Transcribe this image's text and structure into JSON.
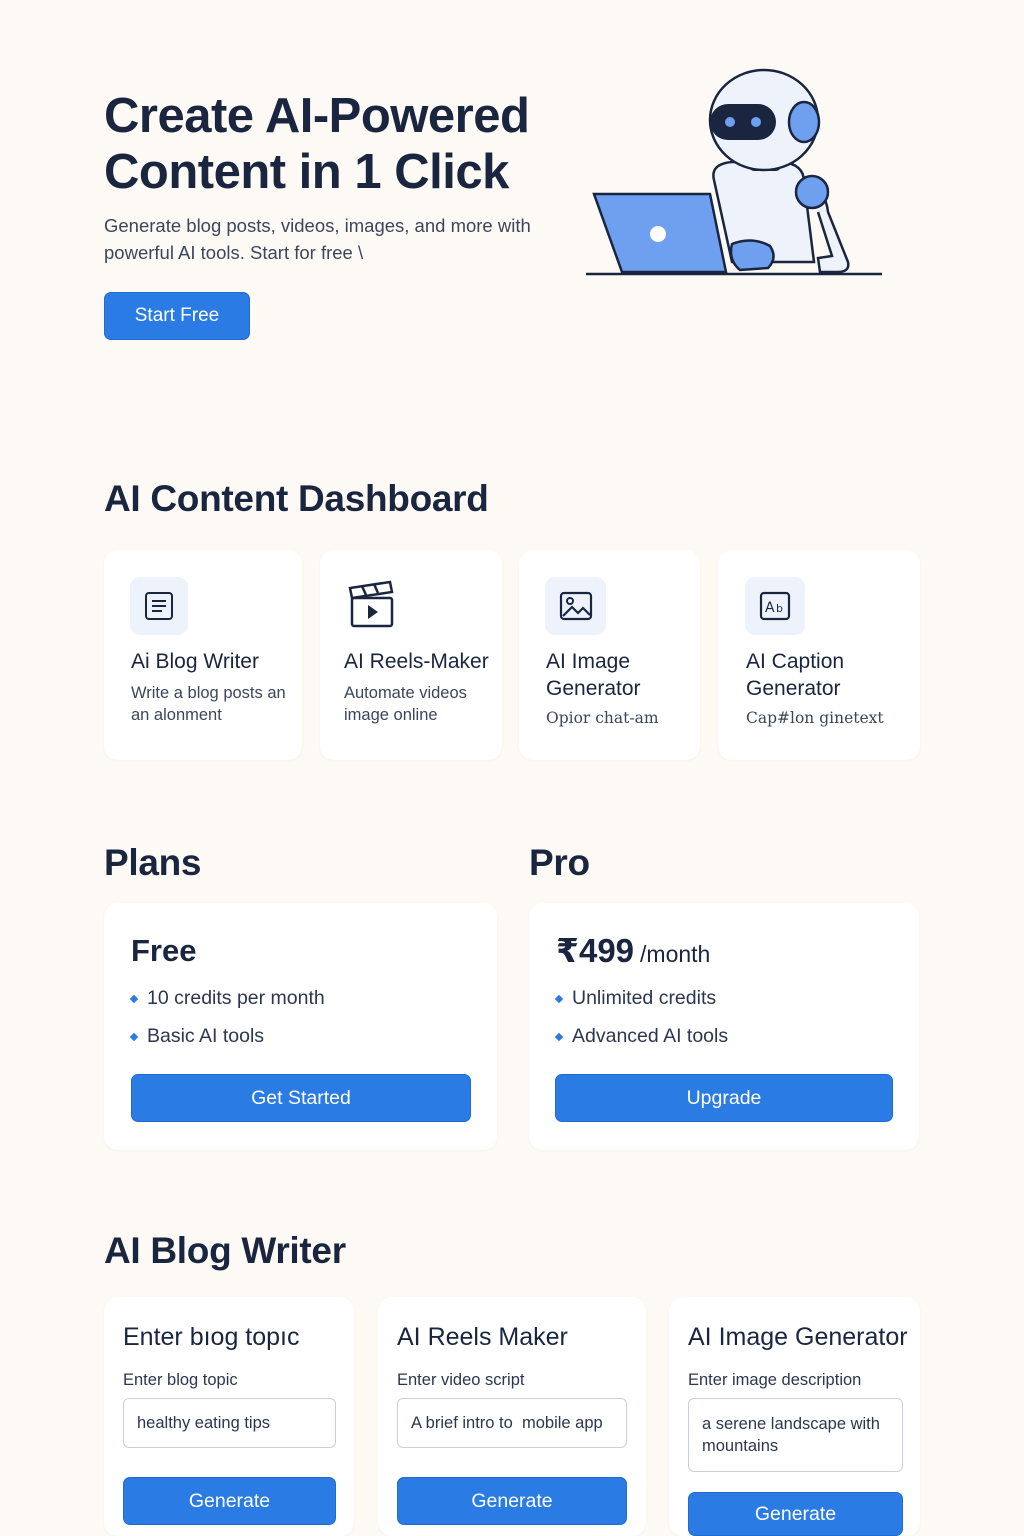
{
  "hero": {
    "title": "Create AI-Powered Content in 1 Click",
    "subtitle": "Generate blog posts, videos, images, and more with powerful AI tools. Start for free \\",
    "cta_label": "Start Free",
    "illustration": "robot-with-laptop"
  },
  "dashboard": {
    "title": "AI Content Dashboard",
    "features": [
      {
        "name": "Ai Blog Writer",
        "desc": "Write a blog posts an an alonment",
        "icon": "document-icon"
      },
      {
        "name": "AI Reels-Maker",
        "desc": "Automate videos image online",
        "icon": "clapperboard-icon"
      },
      {
        "name": "AI Image Generator",
        "desc": "Opior chat-am",
        "icon": "image-icon"
      },
      {
        "name": "AI Caption Generator",
        "desc": "Cap#lon ginetext",
        "icon": "caption-icon"
      }
    ]
  },
  "plans": {
    "title": "Plans",
    "pro_heading": "Pro",
    "free": {
      "name": "Free",
      "items": [
        "10 credits per month",
        "Basic AI tools"
      ],
      "button": "Get Started"
    },
    "pro": {
      "price": "₹499",
      "period": "/month",
      "items": [
        "Unlimited credits",
        "Advanced AI tools"
      ],
      "button": "Upgrade"
    }
  },
  "tools": {
    "title": "AI Blog Writer",
    "cards": [
      {
        "title": "Enter bıog topıc",
        "label": "Enter blog topic",
        "value": "healthy eating tips",
        "button": "Generate"
      },
      {
        "title": "AI Reels Maker",
        "label": "Enter video script",
        "value": "A brief intro to  mobile app",
        "button": "Generate"
      },
      {
        "title": "AI Image Generator",
        "label": "Enter image description",
        "value": "a serene landscape with mountains",
        "button": "Generate"
      }
    ]
  },
  "colors": {
    "background": "#fdfaf5",
    "accent": "#2a7be4",
    "text": "#1a2540"
  }
}
